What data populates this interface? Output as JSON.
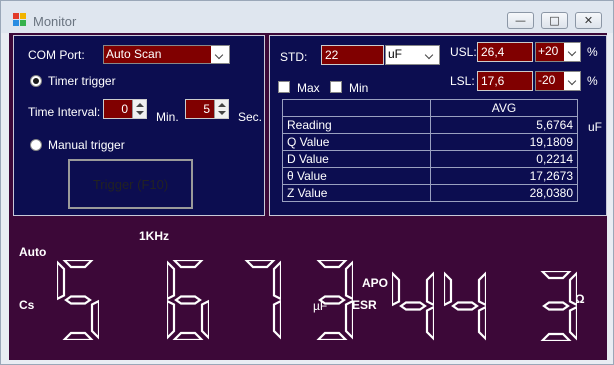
{
  "window": {
    "title": "Monitor",
    "minimize_glyph": "—",
    "maximize_glyph": "□",
    "close_glyph": "✕"
  },
  "controls": {
    "com_port_label": "COM Port:",
    "com_port_value": "Auto Scan",
    "timer_trigger_label": "Timer trigger",
    "timer_trigger_selected": true,
    "time_interval_label": "Time Interval:",
    "minutes_value": "0",
    "minutes_unit": "Min.",
    "seconds_value": "5",
    "seconds_unit": "Sec.",
    "manual_trigger_label": "Manual trigger",
    "manual_trigger_selected": false,
    "trigger_button_label": "Trigger (F10)"
  },
  "settings": {
    "std_label": "STD:",
    "std_value": "22",
    "std_unit": "uF",
    "max_label": "Max",
    "max_checked": false,
    "min_label": "Min",
    "min_checked": false,
    "usl_label": "USL:",
    "usl_value": "26,4",
    "usl_pct": "+20",
    "usl_pct_unit": "%",
    "lsl_label": "LSL:",
    "lsl_value": "17,6",
    "lsl_pct": "-20",
    "lsl_pct_unit": "%"
  },
  "table": {
    "column_header": "AVG",
    "unit": "uF",
    "rows": [
      {
        "label": "Reading",
        "value": "5,6764"
      },
      {
        "label": "Q Value",
        "value": "19,1809"
      },
      {
        "label": "D Value",
        "value": "0,2214"
      },
      {
        "label": "θ Value",
        "value": "17,2673"
      },
      {
        "label": "Z Value",
        "value": "28,0380"
      }
    ]
  },
  "display": {
    "frequency": "1KHz",
    "mode": "Auto",
    "param": "Cs",
    "primary_digits": "5 673",
    "primary_unit": "µF",
    "secondary_top": "APO",
    "secondary_label": "ESR",
    "secondary_digits": "44 3",
    "secondary_unit": "Ω"
  },
  "colors": {
    "panel_bg": "#0c0d50",
    "display_bg": "#3c0838",
    "field_bg": "#800000"
  }
}
